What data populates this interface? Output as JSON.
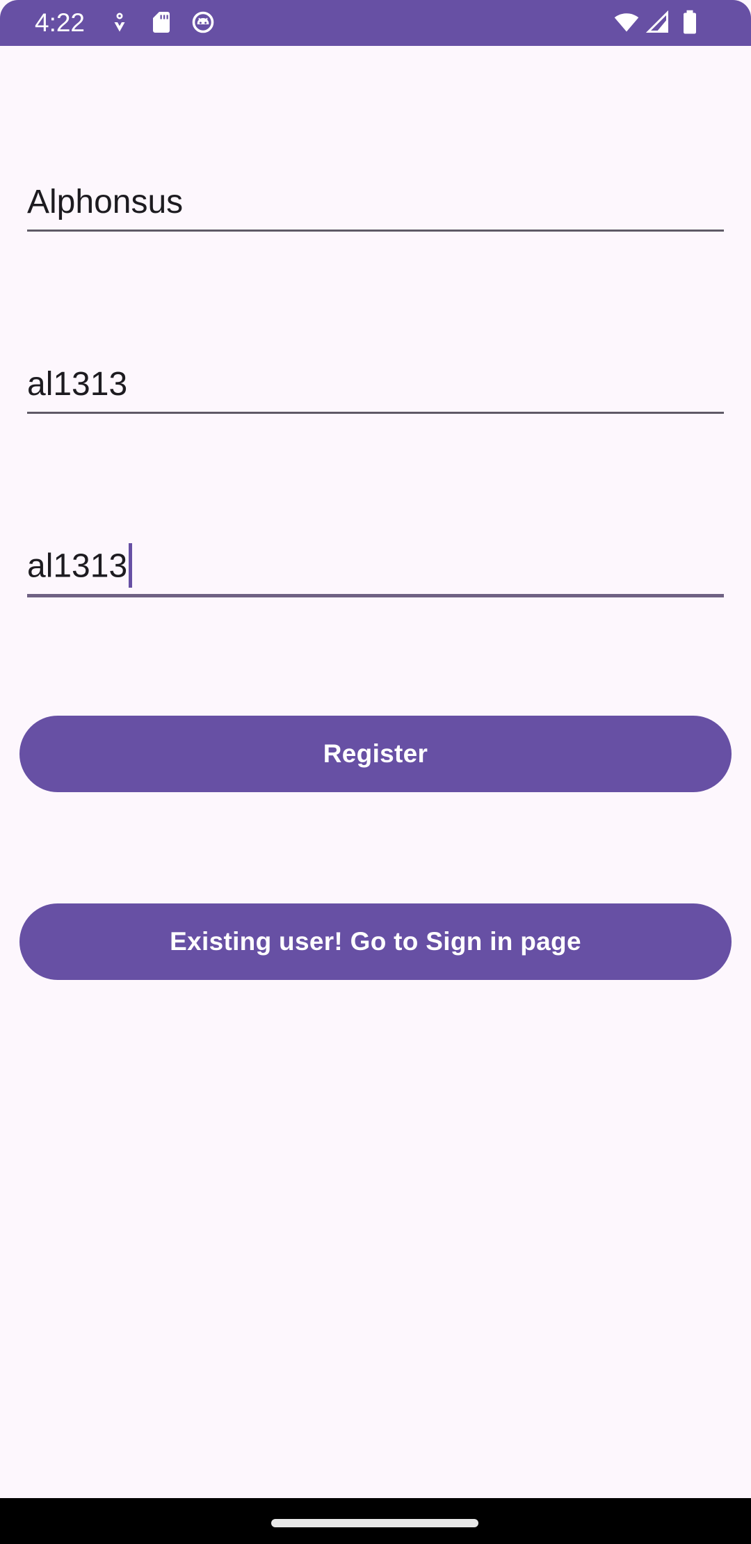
{
  "status_bar": {
    "time": "4:22",
    "left_icons": [
      "sync-icon",
      "sd-card-icon",
      "android-face-icon"
    ],
    "right_icons": [
      "wifi-icon",
      "cellular-signal-icon",
      "battery-icon"
    ],
    "background_color": "#6750a4"
  },
  "form": {
    "name_field": {
      "value": "Alphonsus"
    },
    "username_field": {
      "value": "al1313"
    },
    "password_field": {
      "value": "al1313",
      "focused": true
    }
  },
  "buttons": {
    "register_label": "Register",
    "sign_in_label": "Existing user! Go to Sign in page"
  },
  "colors": {
    "accent": "#6750a4",
    "background": "#fdf7fd",
    "text": "#1d1b20"
  }
}
